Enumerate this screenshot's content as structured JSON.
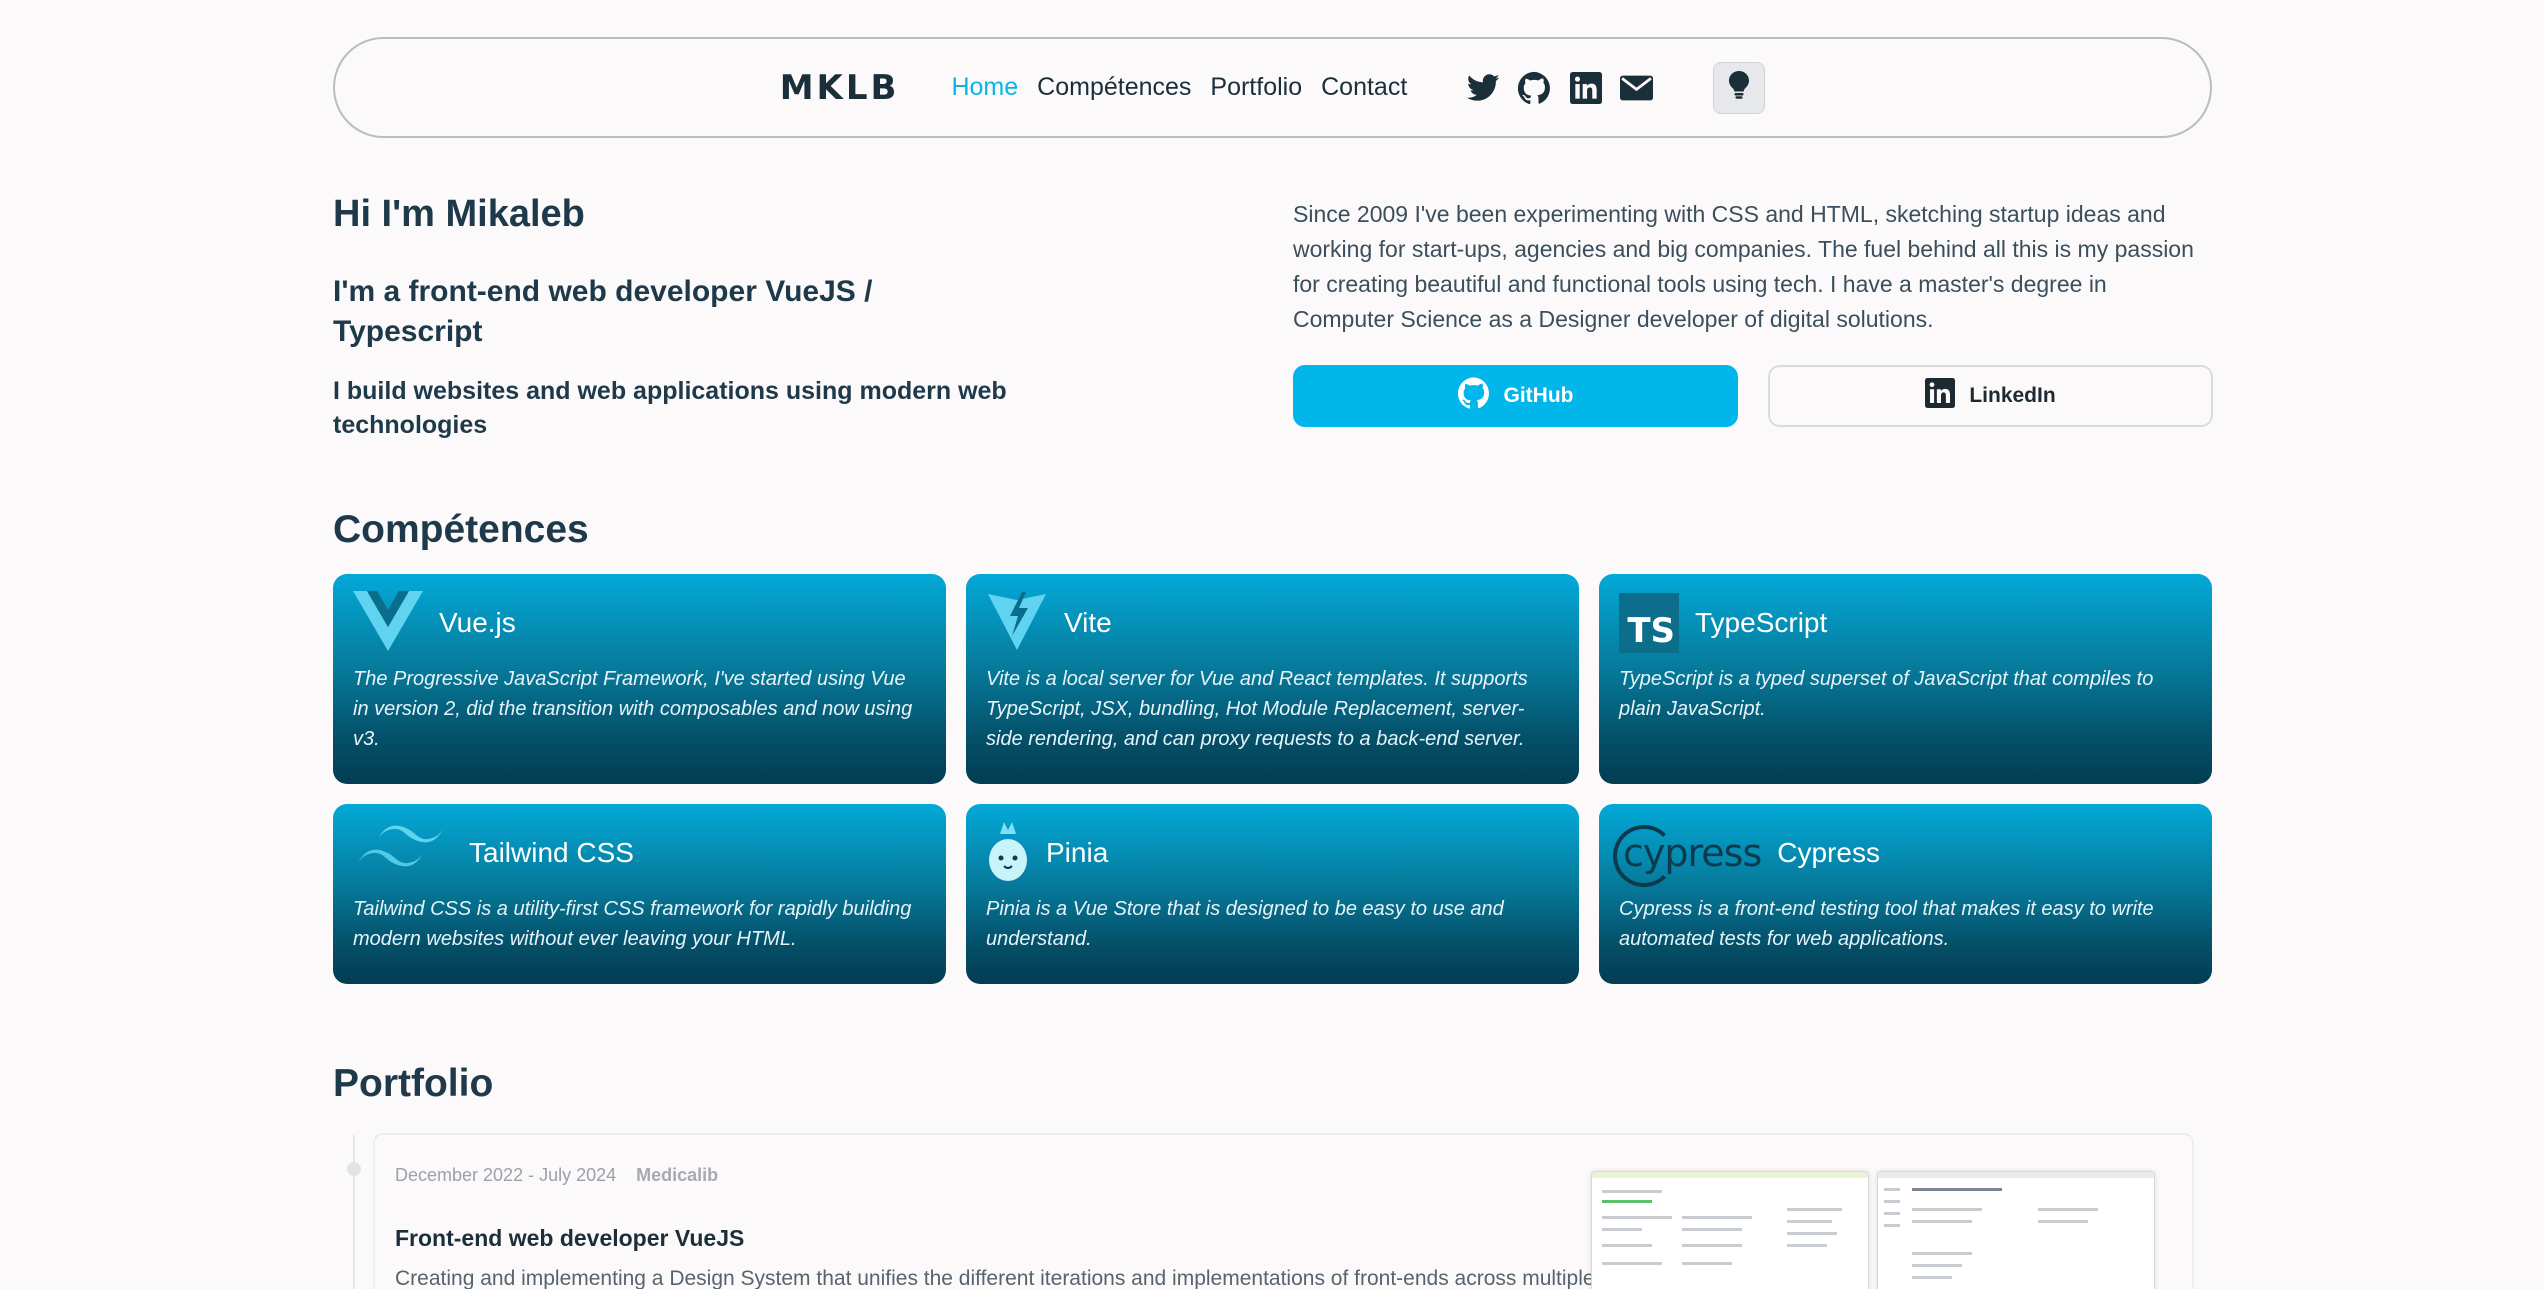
{
  "nav": {
    "logo": "MKLB",
    "links": [
      "Home",
      "Compétences",
      "Portfolio",
      "Contact"
    ],
    "socials": [
      "twitter-icon",
      "github-icon",
      "linkedin-icon",
      "mail-icon"
    ],
    "theme_toggle_icon": "lightbulb-icon"
  },
  "hero": {
    "title": "Hi I'm Mikaleb",
    "subtitle": "I'm a front-end web developer VueJS / Typescript",
    "tagline": "I build websites and web applications using modern web technologies",
    "bio": "Since 2009 I've been experimenting with CSS and HTML, sketching startup ideas and working for start-ups, agencies and big companies. The fuel behind all this is my passion for creating beautiful and functional tools using tech.  I have a master's degree in Computer Science as a Designer developer of digital solutions.",
    "github_label": "GitHub",
    "linkedin_label": "LinkedIn"
  },
  "skills": {
    "title": "Compétences",
    "items": [
      {
        "name": "Vue.js",
        "desc": "The Progressive JavaScript Framework, I've started using Vue in version 2, did the transition with composables and now using v3."
      },
      {
        "name": "Vite",
        "desc": "Vite is a local server for Vue and React templates. It supports TypeScript, JSX, bundling, Hot Module Replacement, server-side rendering, and can proxy requests to a back-end server."
      },
      {
        "name": "TypeScript",
        "desc": "TypeScript is a typed superset of JavaScript that compiles to plain JavaScript.",
        "logo_text": "TS"
      },
      {
        "name": "Tailwind CSS",
        "desc": "Tailwind CSS is a utility-first CSS framework for rapidly building modern websites without ever leaving your HTML."
      },
      {
        "name": "Pinia",
        "desc": "Pinia is a Vue Store that is designed to be easy to use and understand."
      },
      {
        "name": "Cypress",
        "desc": "Cypress is a front-end testing tool that makes it easy to write automated tests for web applications.",
        "logo_text": "cypress"
      }
    ]
  },
  "portfolio": {
    "title": "Portfolio",
    "items": [
      {
        "dates": "December 2022 - July 2024",
        "company": "Medicalib",
        "role": "Front-end web developer VueJS",
        "desc": "Creating and implementing a Design System that unifies the different iterations and implementations of front-ends across multiple"
      }
    ]
  },
  "colors": {
    "accent": "#0ab4e4",
    "button_primary": "#00b6ea",
    "card_top": "#03a9d8",
    "card_bottom": "#033d52",
    "text_dark": "#1e3a4a",
    "background": "#fcf9fa"
  }
}
